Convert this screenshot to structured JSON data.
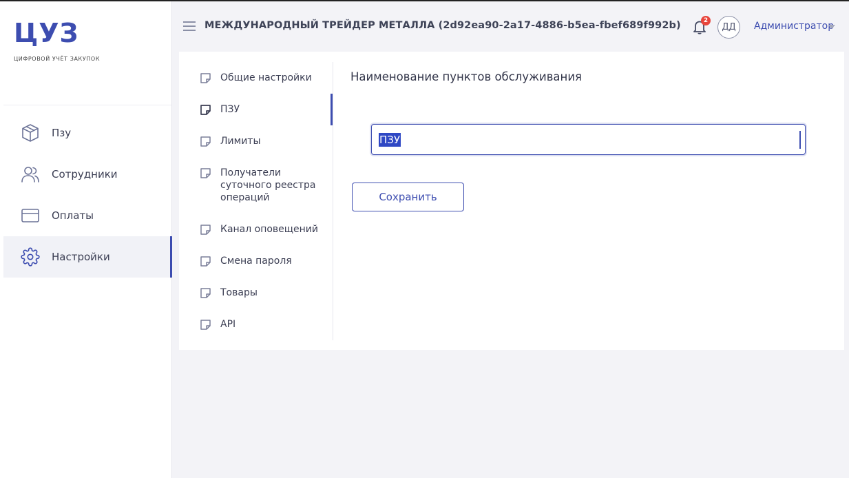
{
  "sidebar": {
    "logo": "ЦУЗ",
    "logo_subtitle": "ЦИФРОВОЙ УЧЁТ ЗАКУПОК",
    "items": [
      {
        "label": "Пзу",
        "icon": "box-icon"
      },
      {
        "label": "Сотрудники",
        "icon": "users-icon"
      },
      {
        "label": "Оплаты",
        "icon": "card-icon"
      },
      {
        "label": "Настройки",
        "icon": "gear-icon",
        "active": true
      }
    ]
  },
  "header": {
    "company": "МЕЖДУНАРОДНЫЙ ТРЕЙДЕР МЕТАЛЛА (2d92ea90-2a17-4886-b5ea-fbef689f992b)",
    "notifications_count": "2",
    "avatar_initials": "ДД",
    "user_name": "Администратор"
  },
  "settings_menu": {
    "items": [
      {
        "label": "Общие настройки"
      },
      {
        "label": "ПЗУ",
        "active": true
      },
      {
        "label": "Лимиты"
      },
      {
        "label": "Получатели суточного реестра операций"
      },
      {
        "label": "Канал оповещений"
      },
      {
        "label": "Смена пароля"
      },
      {
        "label": "Товары"
      },
      {
        "label": "API"
      }
    ]
  },
  "main": {
    "title": "Наименование пунктов обслуживания",
    "field_value": "ПЗУ",
    "save_label": "Сохранить"
  },
  "colors": {
    "accent": "#3d4db0",
    "badge": "#e8453c",
    "selection": "#2f48c4"
  }
}
